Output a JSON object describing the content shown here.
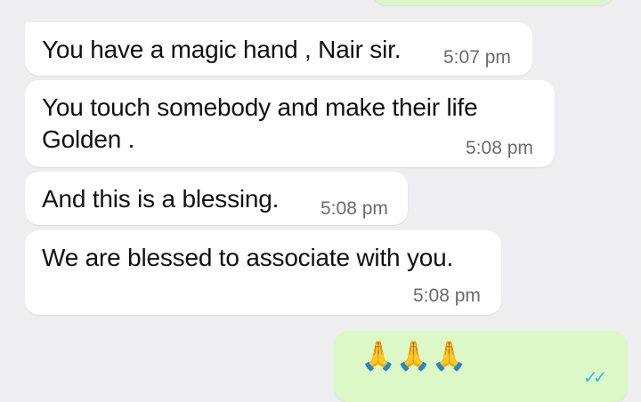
{
  "colors": {
    "background": "#eeeef0",
    "incoming_bubble": "#ffffff",
    "outgoing_bubble": "#dcf8c6",
    "timestamp": "#6b6b6b",
    "read_ticks": "#34b7f1"
  },
  "messages": [
    {
      "direction": "incoming",
      "text": "You have a magic hand , Nair sir.",
      "time": "5:07 pm"
    },
    {
      "direction": "incoming",
      "text": "You touch somebody and make their life Golden .",
      "time": "5:08 pm"
    },
    {
      "direction": "incoming",
      "text": "And this is a blessing.",
      "time": "5:08 pm"
    },
    {
      "direction": "incoming",
      "text": "We are blessed to associate with you.",
      "time": "5:08 pm"
    }
  ],
  "outgoing": {
    "emoji": "🙏🙏🙏",
    "icon": "folded-hands-icon",
    "ticks": "✓✓"
  }
}
